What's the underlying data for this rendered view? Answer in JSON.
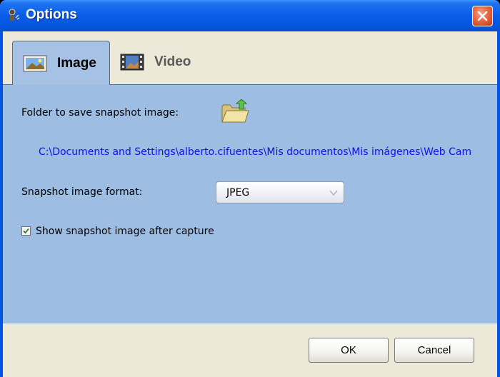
{
  "window": {
    "title": "Options",
    "icon": "webcam-app-icon",
    "close_icon": "close-icon"
  },
  "tabs": [
    {
      "label": "Image",
      "icon": "picture-icon",
      "active": true
    },
    {
      "label": "Video",
      "icon": "film-icon",
      "active": false
    }
  ],
  "image_tab": {
    "folder_label": "Folder to save snapshot image:",
    "folder_button_icon": "open-folder-icon",
    "folder_path": "C:\\Documents and Settings\\alberto.cifuentes\\Mis documentos\\Mis imágenes\\Web Cam",
    "format_label": "Snapshot image format:",
    "format_value": "JPEG",
    "show_after_capture_label": "Show snapshot image after capture",
    "show_after_capture_checked": true
  },
  "buttons": {
    "ok": "OK",
    "cancel": "Cancel"
  },
  "colors": {
    "titlebar": "#0a5ce8",
    "panel": "#9ebde3",
    "path_link": "#1010e8",
    "close": "#e6683f"
  }
}
